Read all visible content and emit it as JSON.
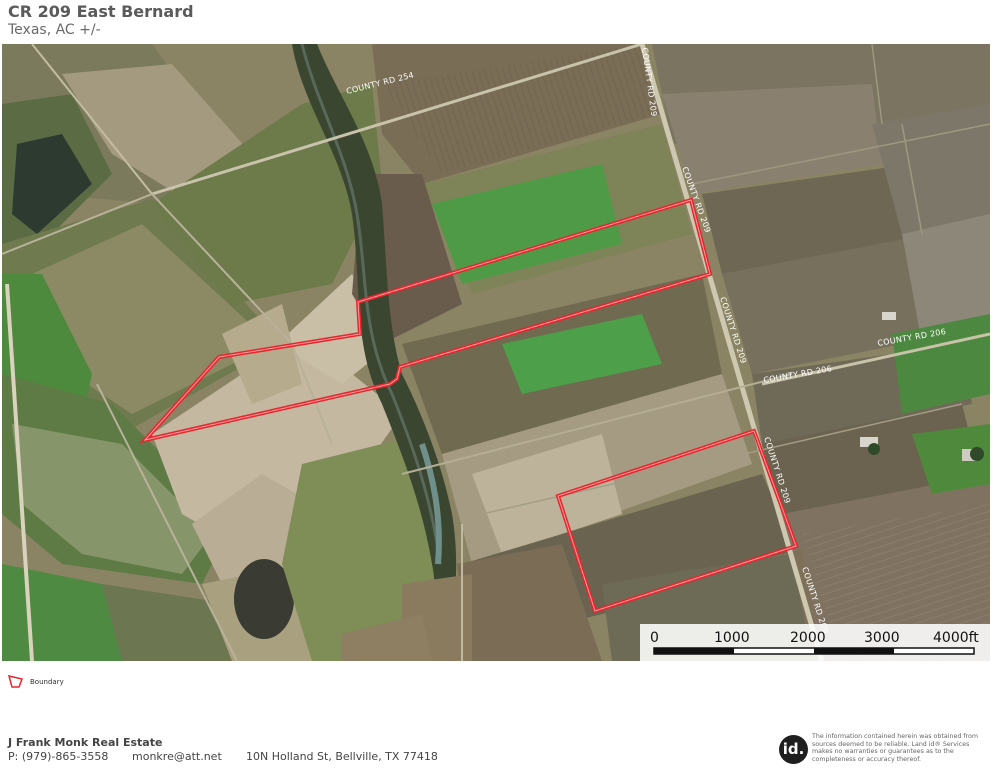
{
  "header": {
    "title": "CR 209 East Bernard",
    "subtitle": "Texas,  AC +/-"
  },
  "map": {
    "roads": {
      "cr254": "COUNTY RD 254",
      "cr209_top": "COUNTY RD 209",
      "cr209_mid": "COUNTY RD 209",
      "cr209_low": "COUNTY RD 209",
      "cr209_bottom": "COUNTY RD 209",
      "cr206_left": "COUNTY RD 206",
      "cr206_right": "COUNTY RD 206"
    },
    "boundary_color": "#e8262d",
    "scale_bar": {
      "labels": [
        "0",
        "1000",
        "2000",
        "3000",
        "4000ft"
      ]
    }
  },
  "legend": {
    "label": "Boundary"
  },
  "footer": {
    "company": "J Frank Monk Real Estate",
    "phone": "P: (979)-865-3558",
    "email": "monkre@att.net",
    "address": "10N Holland St, Bellville, TX 77418",
    "logo_text": "id.",
    "disclaimer": "The information contained herein was obtained from sources deemed to be reliable. Land id® Services makes no warranties or guarantees as to the completeness or accuracy thereof."
  }
}
